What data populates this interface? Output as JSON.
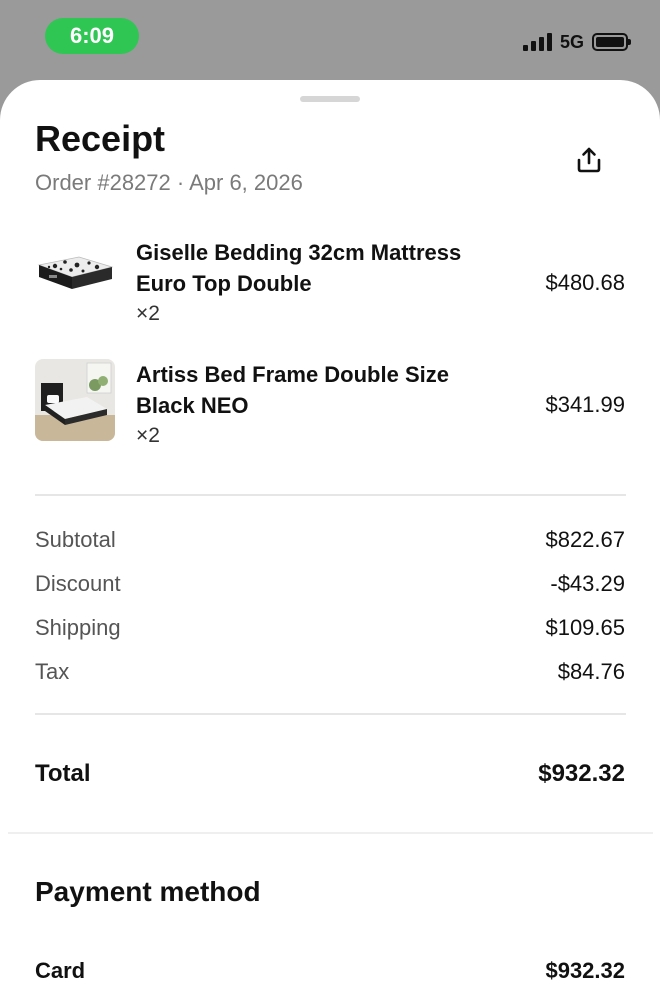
{
  "status_bar": {
    "time": "6:09",
    "network": "5G",
    "battery_level": 1.0,
    "time_pill_color": "#2fc653"
  },
  "receipt": {
    "title": "Receipt",
    "subtitle": "Order #28272 · Apr 6, 2026",
    "share_icon": "share-icon"
  },
  "items": [
    {
      "name_line1": "Giselle Bedding 32cm Mattress",
      "name_line2": "Euro Top Double",
      "qty": "×2",
      "price": "$480.68"
    },
    {
      "name_line1": "Artiss Bed Frame Double Size",
      "name_line2": "Black NEO",
      "qty": "×2",
      "price": "$341.99"
    }
  ],
  "summary": [
    {
      "label": "Subtotal",
      "value": "$822.67"
    },
    {
      "label": "Discount",
      "value": "-$43.29"
    },
    {
      "label": "Shipping",
      "value": "$109.65"
    },
    {
      "label": "Tax",
      "value": "$84.76"
    }
  ],
  "total": {
    "label": "Total",
    "value": "$932.32"
  },
  "payment": {
    "title": "Payment method",
    "label": "Card",
    "value": "$932.32"
  }
}
